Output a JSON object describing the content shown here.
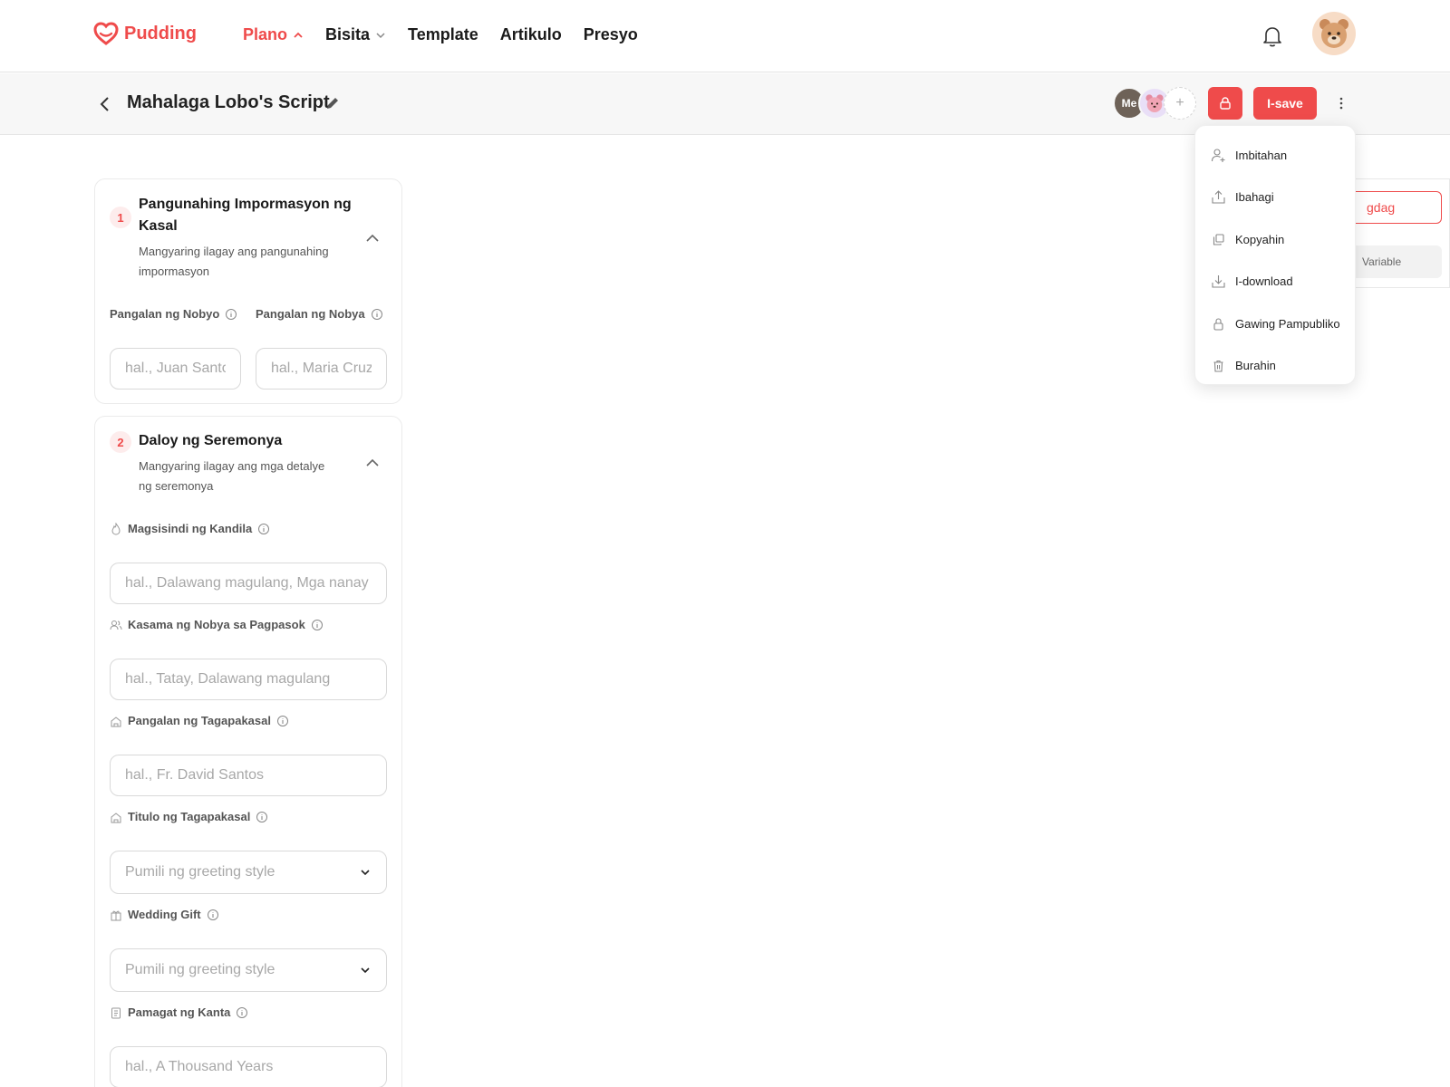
{
  "brand": {
    "name": "Pudding",
    "color": "#ef4b4b"
  },
  "nav": {
    "items": [
      {
        "label": "Plano",
        "active": true,
        "dropdown": "chevron-up"
      },
      {
        "label": "Bisita",
        "active": false,
        "dropdown": "chevron-down"
      },
      {
        "label": "Template",
        "active": false
      },
      {
        "label": "Artikulo",
        "active": false
      },
      {
        "label": "Presyo",
        "active": false
      }
    ]
  },
  "header": {
    "title": "Mahalaga Lobo's Script",
    "collaborators": [
      {
        "label": "Me"
      },
      {
        "label": ""
      },
      {
        "label": "+"
      }
    ],
    "save_label": "I-save"
  },
  "menu": {
    "items": [
      {
        "label": "Imbitahan",
        "icon": "user-plus-icon"
      },
      {
        "label": "Ibahagi",
        "icon": "share-icon"
      },
      {
        "label": "Kopyahin",
        "icon": "copy-icon"
      },
      {
        "label": "I-download",
        "icon": "download-icon"
      },
      {
        "label": "Gawing Pampubliko",
        "icon": "lock-icon"
      },
      {
        "label": "Burahin",
        "icon": "trash-icon"
      }
    ]
  },
  "side_panel": {
    "add_label": "gdag",
    "variable_label": "Variable"
  },
  "sections": [
    {
      "number": "1",
      "title": "Pangunahing Impormasyon ng Kasal",
      "subtitle": "Mangyaring ilagay ang pangunahing impormasyon",
      "fields": [
        {
          "label": "Pangalan ng Nobyo",
          "placeholder": "hal., Juan Santos"
        },
        {
          "label": "Pangalan ng Nobya",
          "placeholder": "hal., Maria Cruz"
        }
      ]
    },
    {
      "number": "2",
      "title": "Daloy ng Seremonya",
      "subtitle": "Mangyaring ilagay ang mga detalye ng seremonya",
      "fields": [
        {
          "label": "Magsisindi ng Kandila",
          "placeholder": "hal., Dalawang magulang, Mga nanay",
          "icon": "flame-icon"
        },
        {
          "label": "Kasama ng Nobya sa Pagpasok",
          "placeholder": "hal., Tatay, Dalawang magulang",
          "icon": "people-icon"
        },
        {
          "label": "Pangalan ng Tagapakasal",
          "placeholder": "hal., Fr. David Santos",
          "icon": "church-icon"
        },
        {
          "label": "Titulo ng Tagapakasal",
          "value": "Pumili ng greeting style",
          "icon": "church-icon",
          "type": "select"
        },
        {
          "label": "Wedding Gift",
          "value": "Pumili ng greeting style",
          "icon": "gift-icon",
          "type": "select"
        },
        {
          "label": "Pamagat ng Kanta",
          "placeholder": "hal., A Thousand Years",
          "icon": "notes-icon"
        }
      ]
    }
  ]
}
